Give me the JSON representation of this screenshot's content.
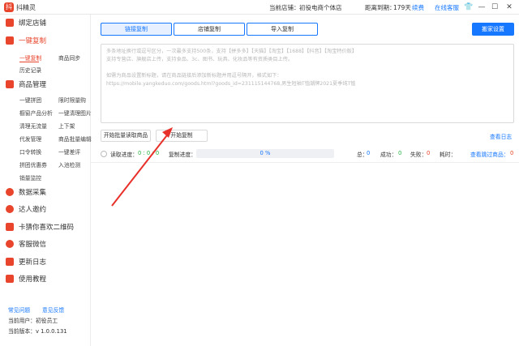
{
  "window": {
    "logo_char": "抖",
    "title": "抖精灵",
    "current_shop_label": "当前店铺：",
    "current_shop_value": "初役电商个体店",
    "expiry_label": "距离到期：",
    "expiry_value": "179天",
    "renew_link": "续费",
    "online_service": "在线客服",
    "buttons": {
      "skin": "👕",
      "minimize": "—",
      "maximize": "☐",
      "close": "✕"
    }
  },
  "sidebar": {
    "sections": [
      {
        "label": "绑定店铺",
        "icon": "shop-icon"
      },
      {
        "label": "一键复制",
        "icon": "copy-icon",
        "active": true
      },
      {
        "label": "商品管理",
        "icon": "goods-icon"
      },
      {
        "label": "数据采集",
        "icon": "collect-icon"
      },
      {
        "label": "达人邀约",
        "icon": "person-icon"
      },
      {
        "label": "卡猜你喜欢二维码",
        "icon": "heart-icon"
      },
      {
        "label": "客服微信",
        "icon": "wechat-icon"
      },
      {
        "label": "更新日志",
        "icon": "log-icon"
      },
      {
        "label": "使用教程",
        "icon": "book-icon"
      }
    ],
    "copy_subs": [
      "一键复制",
      "商品同步",
      "历史记录"
    ],
    "goods_subs": [
      "一键拼团",
      "限时限量购",
      "橱窗产品分析",
      "一键清理图片",
      "清理无流量",
      "上下架",
      "代发管理",
      "商品批量编辑",
      "口令转换",
      "一键差评",
      "拼团优惠券",
      "入池检测",
      "销量监控"
    ],
    "footer": {
      "faq": "常见问题",
      "feedback": "意见反馈",
      "user": "当前用户：初役员工",
      "version": "当前版本：v 1.0.0.131"
    }
  },
  "main": {
    "tabs": [
      "链接复制",
      "店铺复制",
      "导入复制"
    ],
    "move_button": "搬家设置",
    "textarea_lines": [
      "多条地址换行或逗号区分，一次最多支持500条，支持【拼多多】【天猫】【淘宝】【1688】【抖音】【淘宝特价版】",
      "支持专营店、旗舰店上传，支持食品、3c、图书、玩具、化妆品等有资质类目上传。",
      "",
      "如需为商品设置新标题，请在商品链接后添加新标题并用逗号隔开，格式如下：",
      "https://mobile.yangkeduo.com/goods.html?goods_id=231115144768,男生短袖T恤潮牌2021夏季纯T恤"
    ],
    "batch_read_button": "开始批量读取商品",
    "start_copy_button": "开始复制",
    "view_log": "查看日志",
    "status": {
      "read_progress_label": "读取进度：",
      "read_progress_value": "0 : 0 : 0",
      "copy_progress_label": "复制进度：",
      "copy_progress_value": "0 %",
      "copy_progress_fraction": 0,
      "total_label": "总：",
      "total_value": "0",
      "success_label": "成功：",
      "success_value": "0",
      "fail_label": "失败：",
      "fail_value": "0",
      "time_label": "耗时：",
      "time_value": "",
      "view_skipped": "查看跳过商品：",
      "skipped_value": "0"
    }
  },
  "colors": {
    "accent": "#e8452c",
    "link": "#1677ff",
    "success": "#2bb34a"
  }
}
